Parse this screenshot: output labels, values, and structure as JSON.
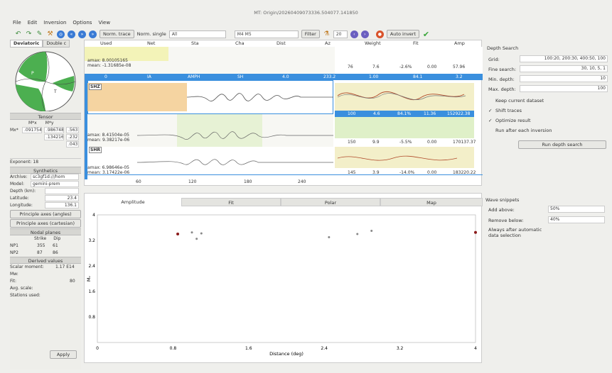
{
  "window": {
    "title": "MT: Origin/20260409073336.504077.141850"
  },
  "menu": [
    "File",
    "Edit",
    "Inversion",
    "Options",
    "View"
  ],
  "toolbar": {
    "norm_trace": "Norm. trace",
    "norm_single": "Norm. single",
    "component_value": "All",
    "model_value": "M4 M5",
    "filter_label": "Filter",
    "filter_value": "20",
    "auto_invert": "Auto invert"
  },
  "left": {
    "tabs": [
      "Deviatoric",
      "Double c"
    ],
    "tensor_title": "Tensor",
    "tensor_headers": [
      "M*x",
      "M*y"
    ],
    "tensor_rows": [
      [
        "Mx*",
        ".091754",
        ".986748",
        ".563"
      ],
      [
        "",
        "",
        ".134216",
        ".232"
      ],
      [
        "",
        "",
        "",
        ".043"
      ]
    ],
    "exponent_label": "Exponent: 18",
    "synthetics_title": "Synthetics",
    "archive_label": "Archive:",
    "archive_value": "sc3gf1d:///hom",
    "model_label": "Model:",
    "model_value": "gemini-prem",
    "depth_label": "Depth (km):",
    "latitude_label": "Latitude:",
    "latitude_value": "23.4",
    "longitude_label": "Longitude:",
    "longitude_value": "136.1",
    "principle_angles": "Principle axes (angles)",
    "principle_cart": "Principle axes (cartesian)",
    "nodal_title": "Nodal planes",
    "nodal_headers": [
      "Strike",
      "Dip"
    ],
    "np1": [
      "NP1",
      "355",
      "61"
    ],
    "np2": [
      "NP2",
      "87",
      "86"
    ],
    "derived_title": "Derived values",
    "scalar_label": "Scalar moment:",
    "scalar_value": "1.17 E14",
    "mw_label": "Mw:",
    "fit_label": "Fit:",
    "fit_value": "80",
    "avg_scale_label": "Avg. scale:",
    "stations_label": "Stations used:",
    "apply": "Apply"
  },
  "waveforms": {
    "headers": [
      "Used",
      "Net",
      "Sta",
      "Cha",
      "Dist",
      "Az",
      "Weight",
      "Fit",
      "Amp"
    ],
    "amax1": "amax: 8.00105165",
    "mean1": "mean: -1.31685e-08",
    "band1": [
      "0",
      "IA",
      "AMPH",
      "SH",
      "4.0",
      "233.2",
      "1.00",
      "84.1",
      "3.2"
    ],
    "row1": [
      "76",
      "7.6",
      "-2.6%",
      "0.00",
      "57.96"
    ],
    "shz": "SHZ",
    "amax2": "amax: 8.41504e-05",
    "mean2": "mean: 9.38217e-06",
    "band2": [
      "100",
      "4.6",
      "84.1%",
      "11.36",
      "152922.38"
    ],
    "row2": [
      "150",
      "9.9",
      "-5.5%",
      "0.00",
      "170137.37"
    ],
    "shr": "SHR",
    "amax3": "amax: 6.98646e-05",
    "mean3": "mean: 3.17422e-06",
    "row3": [
      "145",
      "3.9",
      "-14.0%",
      "0.00",
      "183220.22"
    ],
    "xticks": [
      "60",
      "120",
      "180",
      "240"
    ]
  },
  "bottom": {
    "tabs": [
      "Amplitude",
      "Fit",
      "Polar",
      "Map"
    ],
    "xlabel": "Distance (deg)",
    "ylabel": "Mᵥ"
  },
  "right": {
    "depth_title": "Depth Search",
    "grid_label": "Grid:",
    "grid_value": "100:20, 200:30, 400:50, 100",
    "fine_label": "Fine search:",
    "fine_value": "30, 10, 5, 1",
    "min_label": "Min. depth:",
    "min_value": "10",
    "max_label": "Max. depth:",
    "max_value": "100",
    "keep": "Keep current dataset",
    "shift": "Shift traces",
    "optimize": "Optimize result",
    "runafter": "Run after each inversion",
    "run_btn": "Run depth search",
    "snip_title": "Wave snippets",
    "add_label": "Add above:",
    "add_value": "50%",
    "rem_label": "Remove below:",
    "rem_value": "40%",
    "always": "Always after automatic data selection"
  },
  "chart_data": {
    "type": "scatter",
    "xlabel": "Distance (deg)",
    "ylabel": "Mᵥ",
    "xlim": [
      0,
      4.0
    ],
    "ylim": [
      0,
      4.0
    ],
    "xticks": [
      "0",
      "0.8",
      "1.6",
      "2.4",
      "3.2",
      "4"
    ],
    "yticks": [
      "0.8",
      "1.6",
      "2.4",
      "3.2",
      "4"
    ],
    "points": [
      {
        "x": 0.85,
        "y": 3.4,
        "color": "#8b1a1a"
      },
      {
        "x": 1.0,
        "y": 3.45,
        "color": "#888888"
      },
      {
        "x": 1.05,
        "y": 3.25,
        "color": "#888888"
      },
      {
        "x": 1.1,
        "y": 3.42,
        "color": "#888888"
      },
      {
        "x": 2.45,
        "y": 3.3,
        "color": "#888888"
      },
      {
        "x": 2.75,
        "y": 3.4,
        "color": "#888888"
      },
      {
        "x": 2.9,
        "y": 3.5,
        "color": "#888888"
      },
      {
        "x": 4.0,
        "y": 3.45,
        "color": "#8b1a1a"
      }
    ]
  }
}
